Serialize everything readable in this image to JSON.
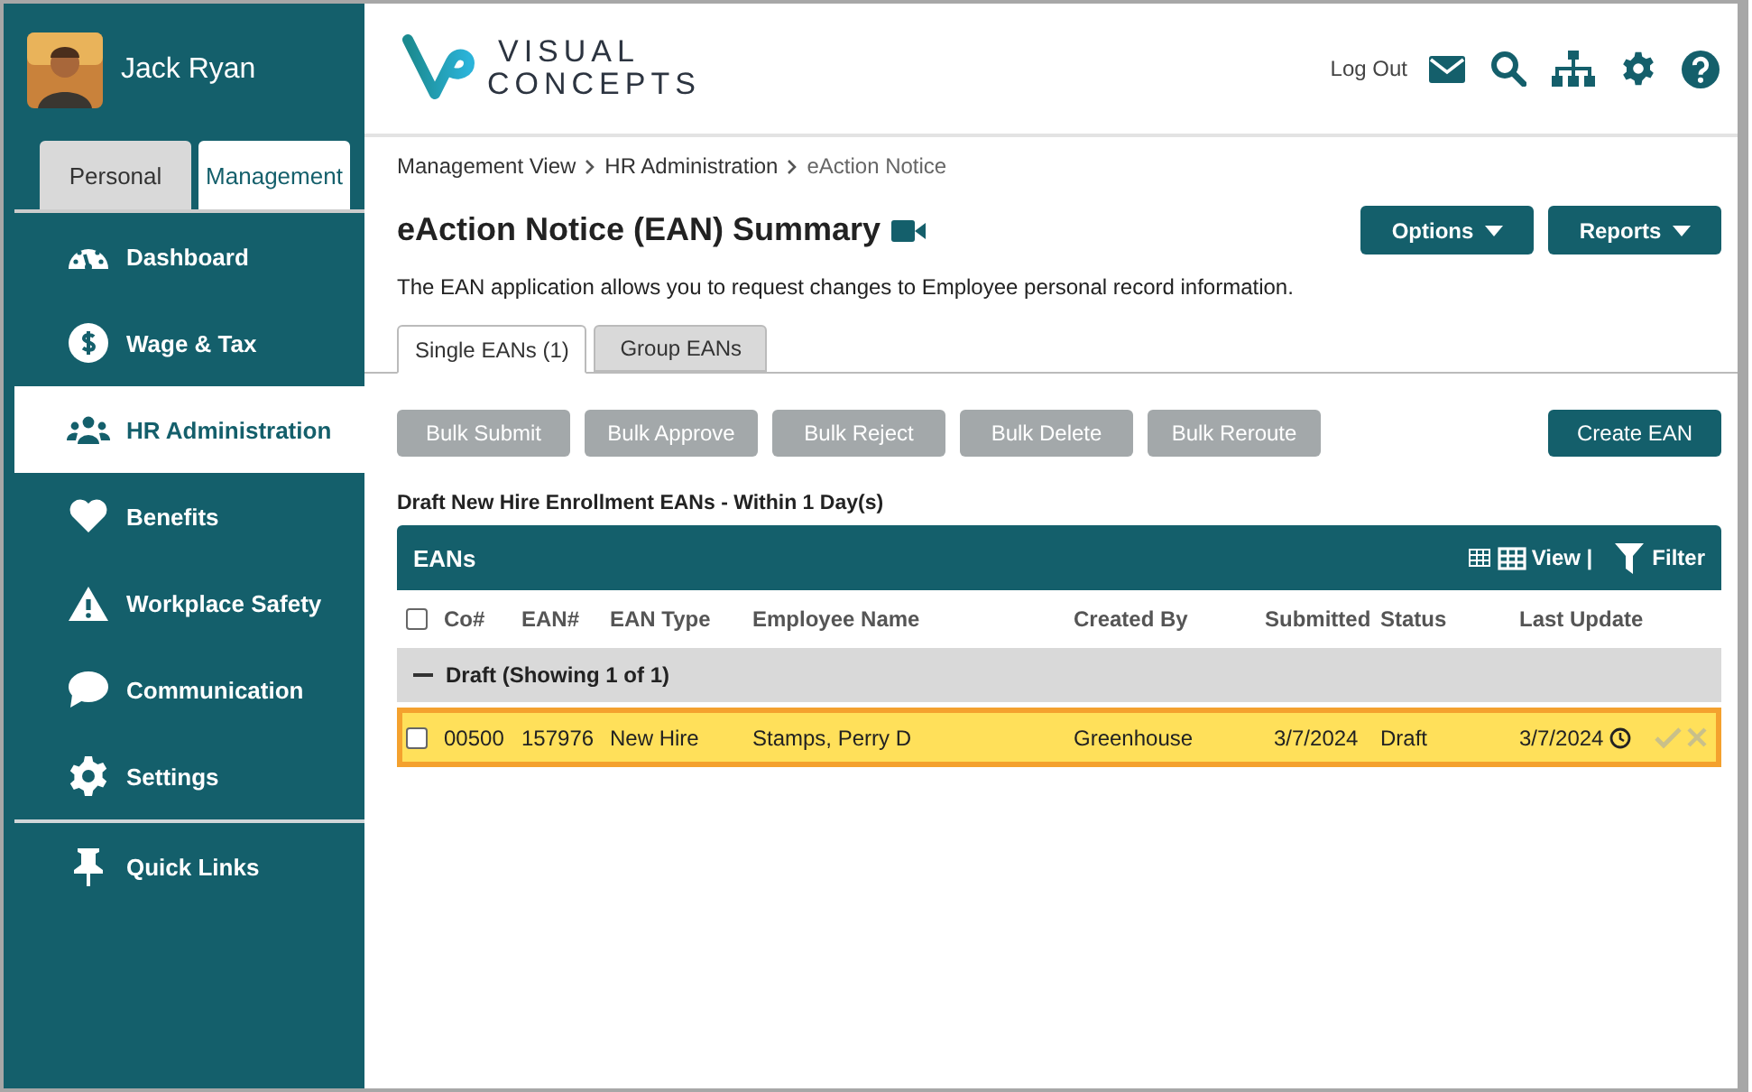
{
  "user": {
    "name": "Jack Ryan"
  },
  "role_tabs": [
    {
      "label": "Personal",
      "selected": false
    },
    {
      "label": "Management",
      "selected": true
    }
  ],
  "nav": [
    {
      "label": "Dashboard",
      "selected": false
    },
    {
      "label": "Wage & Tax",
      "selected": false
    },
    {
      "label": "HR Administration",
      "selected": true
    },
    {
      "label": "Benefits",
      "selected": false
    },
    {
      "label": "Workplace Safety",
      "selected": false
    },
    {
      "label": "Communication",
      "selected": false
    },
    {
      "label": "Settings",
      "selected": false
    }
  ],
  "quick_links": {
    "label": "Quick Links"
  },
  "logo": {
    "line_1": "VISUAL",
    "line_2": "CONCEPTS"
  },
  "header": {
    "logout": "Log Out"
  },
  "breadcrumb": [
    "Management View",
    "HR Administration",
    "eAction Notice"
  ],
  "page": {
    "title": "eAction Notice (EAN) Summary",
    "description": "The EAN application allows you to request changes to Employee personal record information.",
    "menus": [
      "Options",
      "Reports"
    ]
  },
  "tabs": [
    {
      "label": "Single EANs (1)",
      "selected": true
    },
    {
      "label": "Group EANs",
      "selected": false
    }
  ],
  "bulk_actions": [
    {
      "label": "Bulk Submit",
      "disabled": true
    },
    {
      "label": "Bulk Approve",
      "disabled": true
    },
    {
      "label": "Bulk Reject",
      "disabled": true
    },
    {
      "label": "Bulk Delete",
      "disabled": true
    },
    {
      "label": "Bulk Reroute",
      "disabled": true
    }
  ],
  "create_button": "Create EAN",
  "section_title": "Draft New Hire Enrollment EANs - Within 1 Day(s)",
  "table": {
    "title": "EANs",
    "view": "View |",
    "filter": "Filter",
    "columns": [
      "Co#",
      "EAN#",
      "EAN Type",
      "Employee Name",
      "Created By",
      "Submitted",
      "Status",
      "Last Update"
    ],
    "select_all_checked": false,
    "groups": [
      {
        "label": "Draft (Showing 1 of 1)",
        "expanded": true,
        "rows": [
          {
            "cells": [
              "00500",
              "157976",
              "New Hire",
              "Stamps, Perry D",
              "Greenhouse",
              "3/7/2024",
              "Draft",
              "3/7/2024"
            ],
            "checked": false,
            "selected": true,
            "actions_disabled": true
          }
        ]
      }
    ]
  }
}
